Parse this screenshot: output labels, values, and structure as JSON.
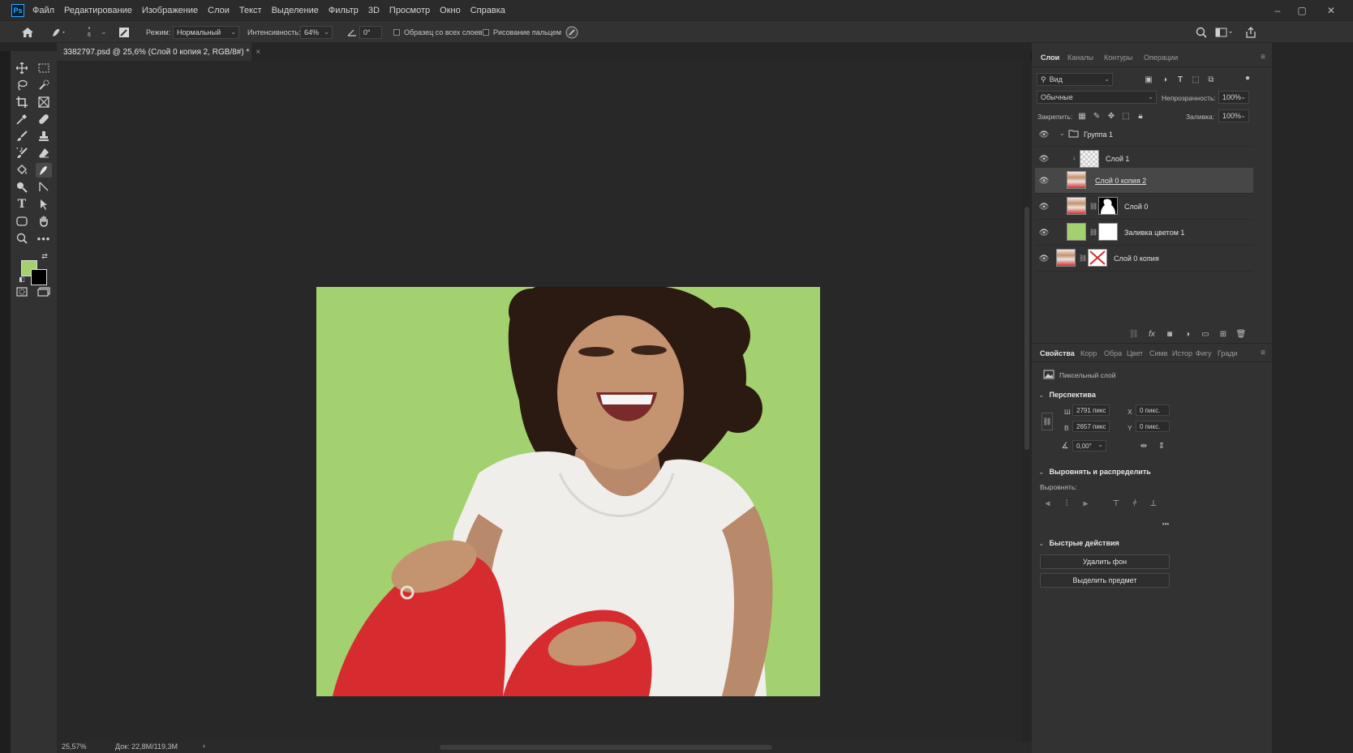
{
  "app": {
    "name": "Ps"
  },
  "menu": [
    "Файл",
    "Редактирование",
    "Изображение",
    "Слои",
    "Текст",
    "Выделение",
    "Фильтр",
    "3D",
    "Просмотр",
    "Окно",
    "Справка"
  ],
  "window_controls": {
    "minimize": "–",
    "maximize": "▢",
    "close": "✕"
  },
  "options": {
    "brush_size": "6",
    "mode_label": "Режим:",
    "mode_value": "Нормальный",
    "intensity_label": "Интенсивность:",
    "intensity_value": "64%",
    "angle_value": "0°",
    "sample_all_label": "Образец со всех слоев",
    "finger_label": "Рисование пальцем"
  },
  "document": {
    "tab_title": "3382797.psd @ 25,6% (Слой 0 копия 2, RGB/8#) *",
    "close": "×"
  },
  "status": {
    "zoom": "25,57%",
    "doc_size": "Док: 22,8M/119,3M",
    "arrow": "›"
  },
  "colors": {
    "foreground": "#a3d16f",
    "background": "#000000",
    "canvas_bg": "#a3d16f"
  },
  "layers_panel": {
    "tabs": [
      "Слои",
      "Каналы",
      "Контуры",
      "Операции"
    ],
    "active_tab": "Слои",
    "filter_value": "Вид",
    "blend_mode": "Обычные",
    "opacity_label": "Непрозрачность:",
    "opacity_value": "100%",
    "lock_label": "Закрепить:",
    "fill_label": "Заливка:",
    "fill_value": "100%",
    "layers": [
      {
        "name": "Группа 1",
        "type": "group"
      },
      {
        "name": "Слой 1",
        "type": "empty"
      },
      {
        "name": "Слой 0 копия 2",
        "type": "photo",
        "selected": true
      },
      {
        "name": "Слой 0",
        "type": "photo-mask"
      },
      {
        "name": "Заливка цветом 1",
        "type": "fill"
      },
      {
        "name": "Слой 0 копия",
        "type": "photo-x"
      }
    ]
  },
  "properties_panel": {
    "tabs": [
      "Свойства",
      "Корр",
      "Обра",
      "Цвет",
      "Симв",
      "Истор",
      "Фигу",
      "Гради"
    ],
    "active_tab": "Свойства",
    "layer_kind": "Пиксельный слой",
    "transform_header": "Перспектива",
    "w_label": "Ш",
    "w_value": "2791 пикс",
    "h_label": "В",
    "h_value": "2657 пикс",
    "x_label": "X",
    "x_value": "0 пикс.",
    "y_label": "Y",
    "y_value": "0 пикс.",
    "angle_value": "0,00°",
    "align_header": "Выровнять и распределить",
    "align_label": "Выровнять:",
    "more": "•••",
    "quick_header": "Быстрые действия",
    "remove_bg": "Удалить фон",
    "select_subject": "Выделить предмет"
  }
}
